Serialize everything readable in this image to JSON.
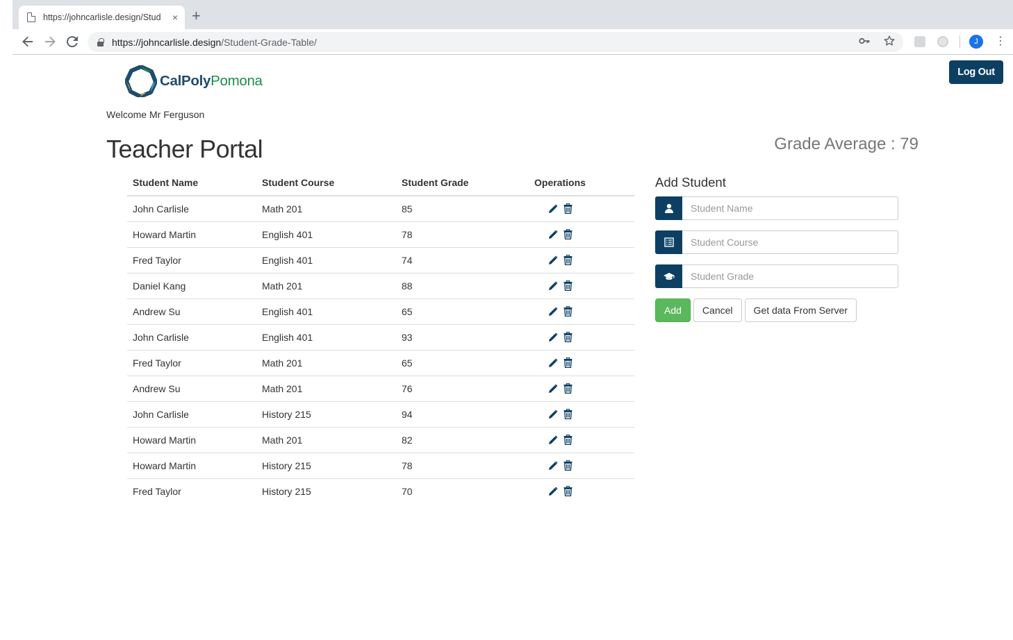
{
  "browser": {
    "tab_title": "https://johncarlisle.design/Stud",
    "tab_close": "×",
    "new_tab": "+",
    "url_host": "https://johncarlisle.design",
    "url_path": "/Student-Grade-Table/",
    "avatar_letter": "J"
  },
  "header": {
    "logo_part1": "CalPoly",
    "logo_part2": "Pomona",
    "logout_label": "Log Out",
    "welcome": "Welcome Mr Ferguson",
    "title": "Teacher Portal",
    "grade_average": "Grade Average : 79"
  },
  "table": {
    "columns": [
      "Student Name",
      "Student Course",
      "Student Grade",
      "Operations"
    ],
    "rows": [
      {
        "name": "John Carlisle",
        "course": "Math 201",
        "grade": "85"
      },
      {
        "name": "Howard Martin",
        "course": "English 401",
        "grade": "78"
      },
      {
        "name": "Fred Taylor",
        "course": "English 401",
        "grade": "74"
      },
      {
        "name": "Daniel Kang",
        "course": "Math 201",
        "grade": "88"
      },
      {
        "name": "Andrew Su",
        "course": "English 401",
        "grade": "65"
      },
      {
        "name": "John Carlisle",
        "course": "English 401",
        "grade": "93"
      },
      {
        "name": "Fred Taylor",
        "course": "Math 201",
        "grade": "65"
      },
      {
        "name": "Andrew Su",
        "course": "Math 201",
        "grade": "76"
      },
      {
        "name": "John Carlisle",
        "course": "History 215",
        "grade": "94"
      },
      {
        "name": "Howard Martin",
        "course": "Math 201",
        "grade": "82"
      },
      {
        "name": "Howard Martin",
        "course": "History 215",
        "grade": "78"
      },
      {
        "name": "Fred Taylor",
        "course": "History 215",
        "grade": "70"
      }
    ]
  },
  "form": {
    "heading": "Add Student",
    "name_placeholder": "Student Name",
    "course_placeholder": "Student Course",
    "grade_placeholder": "Student Grade",
    "add_label": "Add",
    "cancel_label": "Cancel",
    "server_label": "Get data From Server"
  },
  "icons": {
    "edit": "pencil-icon",
    "delete": "trash-icon",
    "name": "user-icon",
    "course": "list-icon",
    "grade": "graduation-cap-icon"
  },
  "colors": {
    "brand": "#0d3f63",
    "success": "#5cb85c",
    "logo_blue": "#1e4d6b",
    "logo_green": "#1d8c4a"
  }
}
